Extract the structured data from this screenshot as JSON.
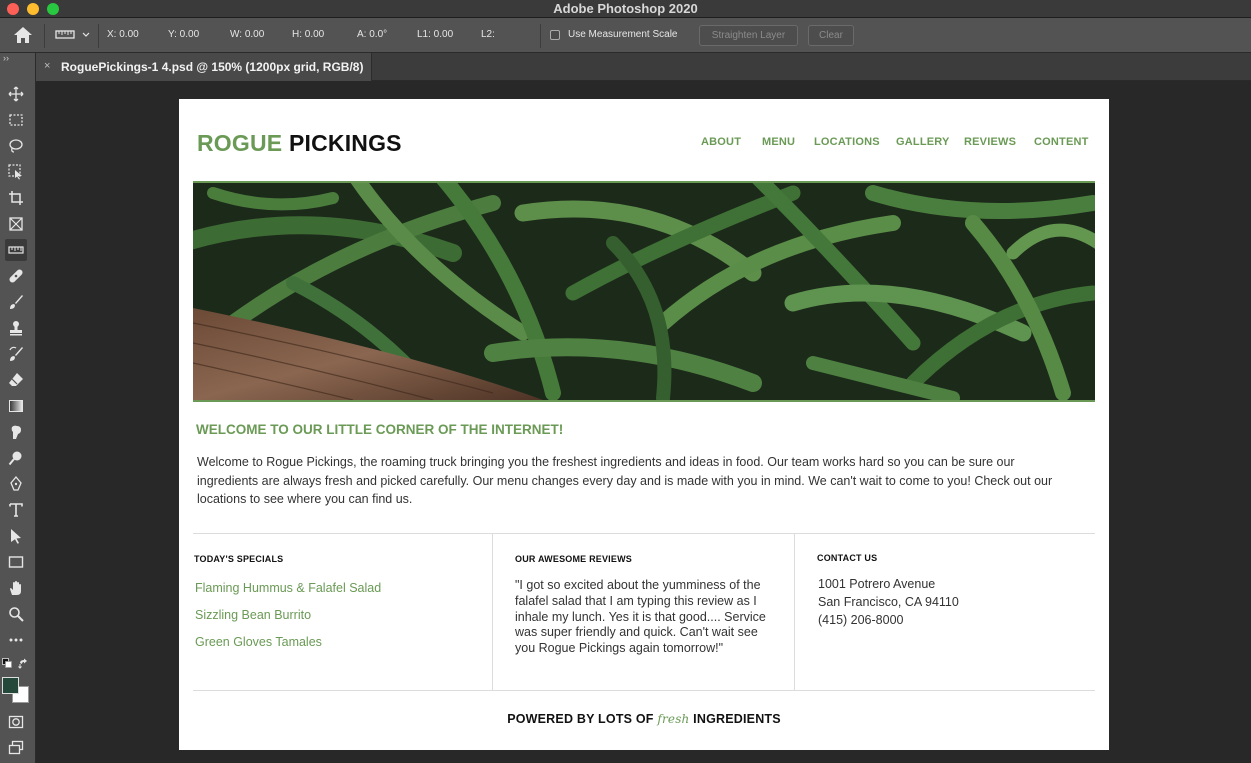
{
  "window": {
    "title": "Adobe Photoshop 2020"
  },
  "options_bar": {
    "x": "X: 0.00",
    "y": "Y: 0.00",
    "w": "W: 0.00",
    "h": "H: 0.00",
    "a": "A: 0.0°",
    "l1": "L1: 0.00",
    "l2": "L2:",
    "use_measurement_scale": "Use Measurement Scale",
    "use_measurement_scale_checked": false,
    "straighten_layer": "Straighten Layer",
    "clear": "Clear"
  },
  "document_tab": {
    "close": "×",
    "label": "RoguePickings-1 4.psd @ 150% (1200px grid, RGB/8)"
  },
  "toolbar": {
    "expand": "››",
    "tools": [
      "move-icon",
      "marquee-icon",
      "lasso-icon",
      "object-select-icon",
      "crop-icon",
      "frame-icon",
      "ruler-icon",
      "healing-icon",
      "brush-icon",
      "stamp-icon",
      "history-brush-icon",
      "eraser-icon",
      "gradient-icon",
      "smudge-icon",
      "dodge-icon",
      "pen-icon",
      "type-icon",
      "path-select-icon",
      "rectangle-icon",
      "hand-icon",
      "zoom-icon",
      "more-icon"
    ],
    "foreground_color": "#24483a",
    "background_color": "#ffffff"
  },
  "site": {
    "brand_first": "ROGUE",
    "brand_second": "PICKINGS",
    "nav": [
      "ABOUT",
      "MENU",
      "LOCATIONS",
      "GALLERY",
      "REVIEWS",
      "CONTENT"
    ],
    "welcome": "WELCOME TO OUR LITTLE CORNER OF THE INTERNET!",
    "intro": "Welcome to Rogue Pickings, the roaming truck bringing you the freshest ingredients and ideas in food. Our team works hard so you can be sure our ingredients are always fresh and picked carefully. Our menu changes every day and is made with you in mind. We can't wait to come to you! Check out our locations to see where you can find us.",
    "specials_heading": "TODAY'S SPECIALS",
    "specials": [
      "Flaming Hummus & Falafel Salad",
      "Sizzling Bean Burrito",
      "Green Gloves Tamales"
    ],
    "reviews_heading": "OUR AWESOME REVIEWS",
    "review": "\"I got so excited about the yumminess of the falafel salad that I am typing this review as I inhale my lunch. Yes it is that good.... Service was super friendly and quick. Can't wait see you Rogue Pickings again tomorrow!\"",
    "contact_heading": "CONTACT US",
    "contact": [
      "1001 Potrero Avenue",
      "San Francisco, CA 94110",
      "(415) 206-8000"
    ],
    "footer_before": "POWERED BY LOTS OF",
    "footer_fresh": "fresh",
    "footer_after": "INGREDIENTS",
    "accent_color": "#6a9a55"
  }
}
